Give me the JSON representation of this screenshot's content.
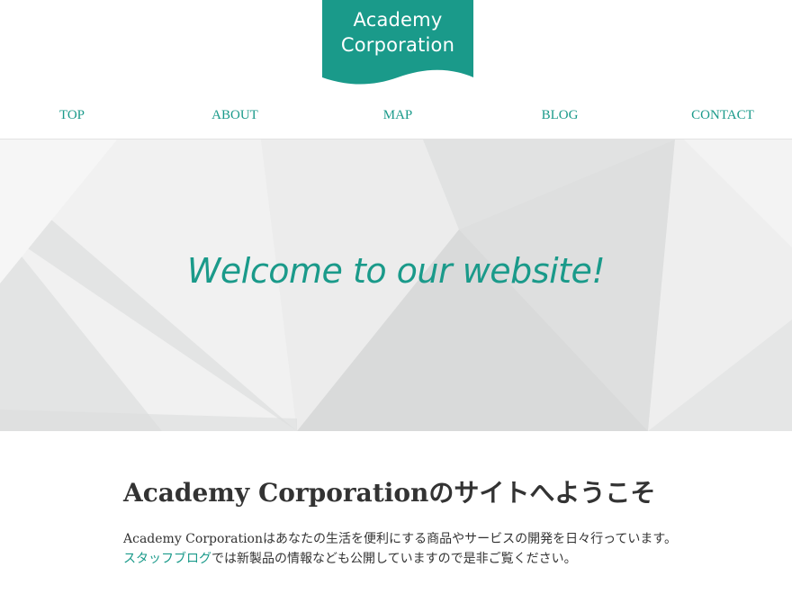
{
  "logo": {
    "line1": "Academy",
    "line2": "Corporation",
    "color": "#1a9a8a"
  },
  "nav": {
    "items": [
      {
        "label": "TOP"
      },
      {
        "label": "ABOUT"
      },
      {
        "label": "MAP"
      },
      {
        "label": "BLOG"
      },
      {
        "label": "CONTACT"
      }
    ],
    "color": "#1a9a8a"
  },
  "hero": {
    "headline": "Welcome to our website!"
  },
  "main": {
    "title": "Academy Corporationのサイトへようこそ",
    "para_line1": "Academy Corporationはあなたの生活を便利にする商品やサービスの開発を日々行っています。",
    "blog_link": "スタッフブログ",
    "para_line2_rest": "では新製品の情報なども公開していますので是非ご覧ください。"
  }
}
